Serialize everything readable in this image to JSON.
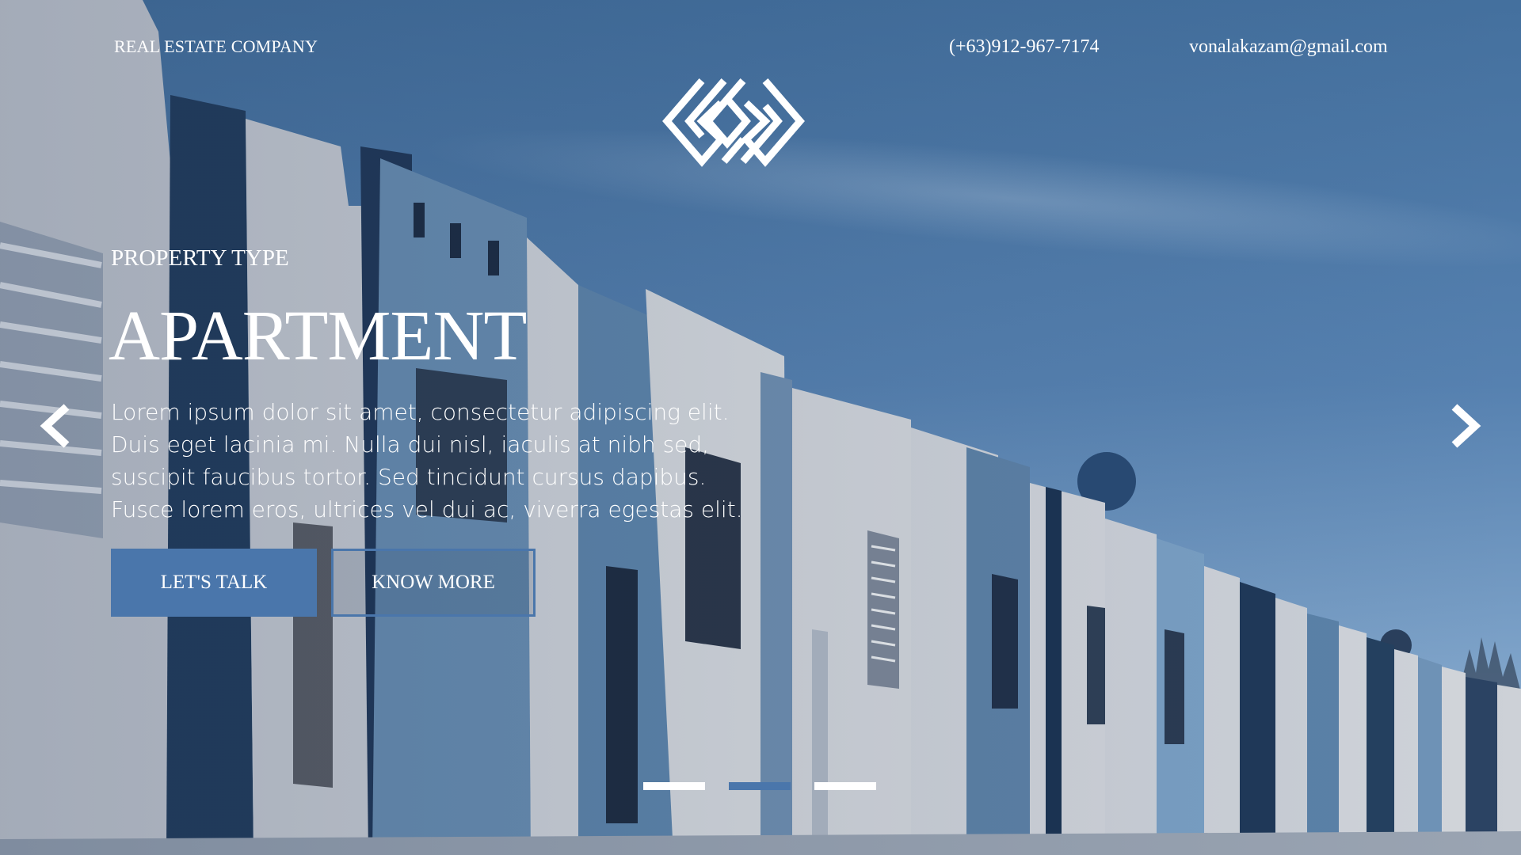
{
  "header": {
    "brand": "REAL ESTATE COMPANY",
    "phone": "(+63)912-967-7174",
    "email": "vonalakazam@gmail.com"
  },
  "hero": {
    "eyebrow": "PROPERTY TYPE",
    "title": "APARTMENT",
    "description": "Lorem ipsum dolor sit amet, consectetur adipiscing elit. Duis eget lacinia mi. Nulla dui nisl, iaculis at nibh sed, suscipit faucibus tortor. Sed tincidunt cursus dapibus. Fusce lorem eros, ultrices vel dui ac, viverra egestas elit."
  },
  "buttons": {
    "primary_label": "LET'S TALK",
    "secondary_label": "KNOW MORE"
  },
  "carousel": {
    "slide_count": 3,
    "active_index": 1
  },
  "icons": {
    "logo": "diamond-knot-logo-icon",
    "prev": "chevron-left-icon",
    "next": "chevron-right-icon"
  },
  "colors": {
    "accent": "#4a76ab",
    "text": "#ffffff",
    "sky": "#4a74a2"
  }
}
